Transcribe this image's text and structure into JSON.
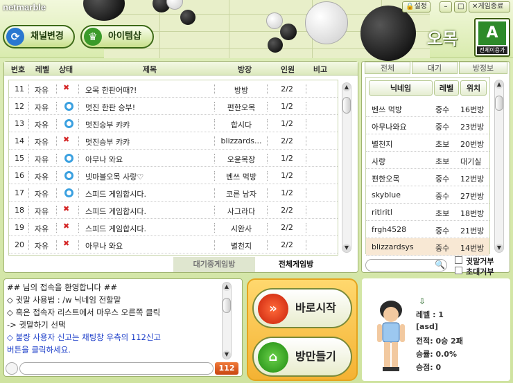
{
  "app": {
    "logo": "netmarble",
    "game_title": "오목",
    "all_user_label": "전체이용가"
  },
  "window": {
    "settings": "설정",
    "minimize": "–",
    "maximize": "□",
    "close_label": "게임종료"
  },
  "top_buttons": {
    "channel": "채널변경",
    "item_shop": "아이템샵"
  },
  "room_list": {
    "headers": [
      "번호",
      "레벨",
      "상태",
      "제목",
      "방장",
      "인원",
      "비고"
    ],
    "rows": [
      {
        "no": "11",
        "level": "자유",
        "status": "x",
        "title": "오목 한판어때?!",
        "owner": "방방",
        "count": "2/2"
      },
      {
        "no": "12",
        "level": "자유",
        "status": "o",
        "title": "멋진 한판 승부!",
        "owner": "편한오목",
        "count": "1/2"
      },
      {
        "no": "13",
        "level": "자유",
        "status": "o",
        "title": "멋진승부 캬캬",
        "owner": "합시다",
        "count": "1/2"
      },
      {
        "no": "14",
        "level": "자유",
        "status": "x",
        "title": "멋진승부 캬캬",
        "owner": "blizzards...",
        "count": "2/2"
      },
      {
        "no": "15",
        "level": "자유",
        "status": "o",
        "title": "아무나 와요",
        "owner": "오윤목장",
        "count": "1/2"
      },
      {
        "no": "16",
        "level": "자유",
        "status": "o",
        "title": "넷마블오목 사랑♡",
        "owner": "벤쓰 먹방",
        "count": "1/2"
      },
      {
        "no": "17",
        "level": "자유",
        "status": "o",
        "title": "스피드 게임합시다.",
        "owner": "코른 남자",
        "count": "1/2"
      },
      {
        "no": "18",
        "level": "자유",
        "status": "x",
        "title": "스피드 게임합시다.",
        "owner": "사그라다",
        "count": "2/2"
      },
      {
        "no": "19",
        "level": "자유",
        "status": "x",
        "title": "스피드 게임합시다.",
        "owner": "시완사",
        "count": "2/2"
      },
      {
        "no": "20",
        "level": "자유",
        "status": "x",
        "title": "아무나 와요",
        "owner": "별천지",
        "count": "2/2"
      }
    ],
    "tabs": [
      "대기중게임방",
      "전체게임방"
    ]
  },
  "user_panel": {
    "tabs": [
      "전체",
      "대기",
      "방정보"
    ],
    "headers": [
      "닉네임",
      "레벨",
      "위치"
    ],
    "users": [
      {
        "nick": "벤쓰 먹방",
        "level": "중수",
        "loc": "16번방"
      },
      {
        "nick": "아무나와요",
        "level": "중수",
        "loc": "23번방"
      },
      {
        "nick": "별천지",
        "level": "초보",
        "loc": "20번방"
      },
      {
        "nick": "사랑",
        "level": "초보",
        "loc": "대기실"
      },
      {
        "nick": "편한오목",
        "level": "중수",
        "loc": "12번방"
      },
      {
        "nick": "skyblue",
        "level": "중수",
        "loc": "27번방"
      },
      {
        "nick": "ritlritl",
        "level": "초보",
        "loc": "18번방"
      },
      {
        "nick": "frgh4528",
        "level": "중수",
        "loc": "21번방"
      },
      {
        "nick": "blizzardsys",
        "level": "중수",
        "loc": "14번방"
      }
    ],
    "whisper_refuse": "귓말거부",
    "invite_refuse": "초대거부"
  },
  "chat": {
    "lines": [
      {
        "text": "##  님의 접속을 환영합니다 ##",
        "color": "#222"
      },
      {
        "text": "◇ 귓말 사용법 : /w 닉네임 전할말",
        "color": "#222"
      },
      {
        "text": "◇ 혹은 접속자 리스트에서 마우스 오른쪽 클릭",
        "color": "#222"
      },
      {
        "text": "-> 귓말하기 선택",
        "color": "#222"
      },
      {
        "text": "◇ 불량 사용자 신고는 채팅창 우측의 112신고",
        "color": "#1a3cc8"
      },
      {
        "text": "버튼을 클릭하세요.",
        "color": "#1a3cc8"
      }
    ],
    "report_label": "112"
  },
  "actions": {
    "quick_start": "바로시작",
    "make_room": "방만들기"
  },
  "profile": {
    "level": "레벨 : 1",
    "nick": "[asd]",
    "record": "전적: 0승 2패",
    "win_rate": "승률: 0.0%",
    "points": "승점: 0"
  },
  "colors": {
    "accent": "#3d6a18",
    "panel_border": "#9fb36f",
    "action_bg": "#f4b233"
  }
}
